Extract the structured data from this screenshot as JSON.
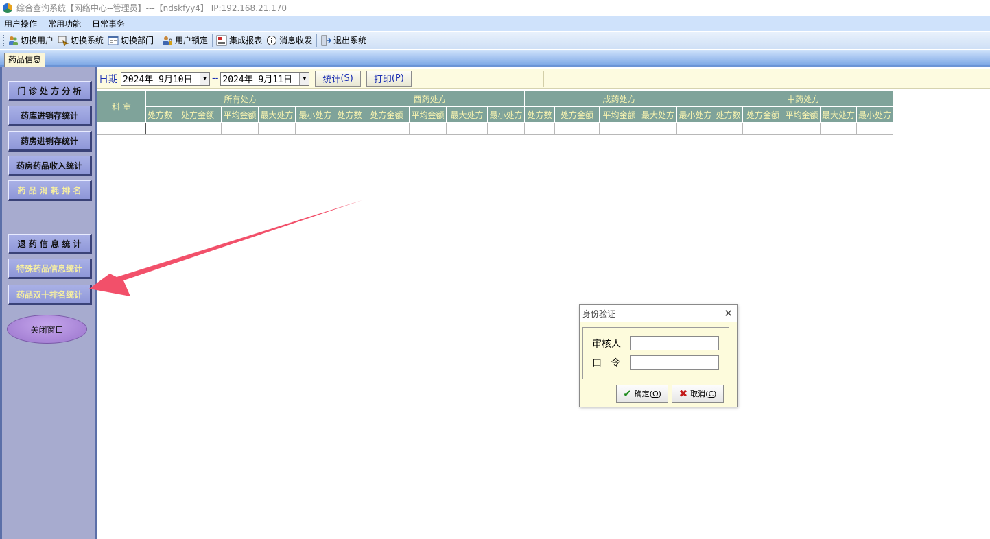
{
  "window": {
    "title": "综合查询系统【网络中心--管理员】---【ndskfyy4】 IP:192.168.21.170"
  },
  "menu": [
    "用户操作",
    "常用功能",
    "日常事务"
  ],
  "toolbar": {
    "items": [
      {
        "label": "切换用户",
        "icon": "switch-user-icon"
      },
      {
        "label": "切换系统",
        "icon": "switch-system-icon"
      },
      {
        "label": "切换部门",
        "icon": "switch-department-icon"
      },
      {
        "label": "用户锁定",
        "icon": "user-lock-icon"
      },
      {
        "label": "集成报表",
        "icon": "report-icon"
      },
      {
        "label": "消息收发",
        "icon": "message-icon"
      },
      {
        "label": "退出系统",
        "icon": "exit-icon"
      }
    ]
  },
  "tab": {
    "label": "药品信息"
  },
  "nav": {
    "items": [
      "门 诊 处 方 分 析",
      "药库进销存统计",
      "药房进销存统计",
      "药房药品收入统计",
      "药 品 消 耗 排 名",
      "退 药 信 息 统 计",
      "特殊药品信息统计",
      "药品双十排名统计"
    ],
    "close_label": "关闭窗口"
  },
  "filter": {
    "date_label": "日期",
    "start_date": "2024年  9月10日",
    "separator": "--",
    "end_date": "2024年  9月11日",
    "stat_button": "统计",
    "stat_key": "S",
    "print_button": "打印",
    "print_key": "P"
  },
  "grid": {
    "dept_header": "科 室",
    "groups": [
      "所有处方",
      "西药处方",
      "成药处方",
      "中药处方"
    ],
    "sub_headers": [
      "处方数",
      "处方金额",
      "平均金额",
      "最大处方",
      "最小处方"
    ]
  },
  "dialog": {
    "title": "身份验证",
    "reviewer_label": "审核人",
    "password_label": "口   令",
    "reviewer_value": "",
    "password_value": "",
    "ok_label": "确定",
    "ok_key": "O",
    "cancel_label": "取消",
    "cancel_key": "C"
  },
  "colors": {
    "grid_header_bg": "#7fa39a",
    "grid_header_text": "#f7f3b0",
    "nav_bg": "#a7abcf",
    "annotation_arrow": "#f2506a"
  }
}
